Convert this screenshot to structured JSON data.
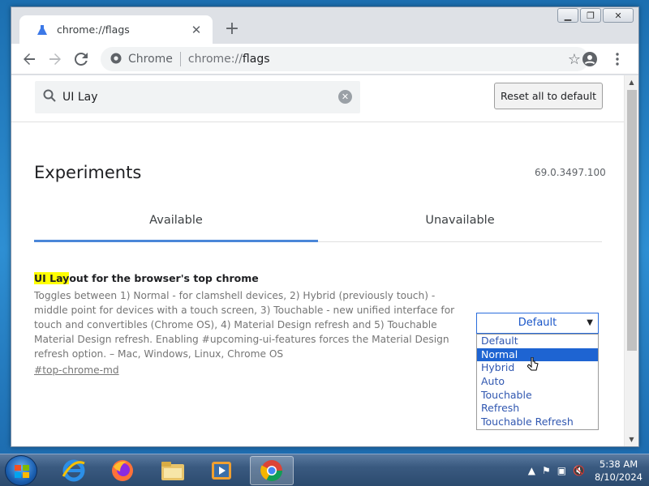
{
  "browser": {
    "tab_title": "chrome://flags",
    "omnibox_chip": "Chrome",
    "url_scheme": "chrome://",
    "url_host": "flags"
  },
  "search": {
    "value": "UI Lay"
  },
  "reset_button": "Reset all to default",
  "experiments": {
    "title": "Experiments",
    "version": "69.0.3497.100",
    "tabs": [
      {
        "label": "Available",
        "active": true
      },
      {
        "label": "Unavailable",
        "active": false
      }
    ]
  },
  "flag": {
    "title_highlight": "UI Lay",
    "title_rest": "out for the browser's top chrome",
    "description": "Toggles between 1) Normal - for clamshell devices, 2) Hybrid (previously touch) - middle point for devices with a touch screen, 3) Touchable - new unified interface for touch and convertibles (Chrome OS), 4) Material Design refresh and 5) Touchable Material Design refresh. Enabling #upcoming-ui-features forces the Material Design refresh option. – Mac, Windows, Linux, Chrome OS",
    "link": "#top-chrome-md",
    "select_value": "Default",
    "options": [
      "Default",
      "Normal",
      "Hybrid",
      "Auto",
      "Touchable",
      "Refresh",
      "Touchable Refresh"
    ],
    "highlighted_option": "Normal"
  },
  "taskbar": {
    "time": "5:38 AM",
    "date": "8/10/2024"
  },
  "colors": {
    "accent": "#4a86d8",
    "highlight": "#ffff00",
    "selected_option": "#1e64d2"
  }
}
